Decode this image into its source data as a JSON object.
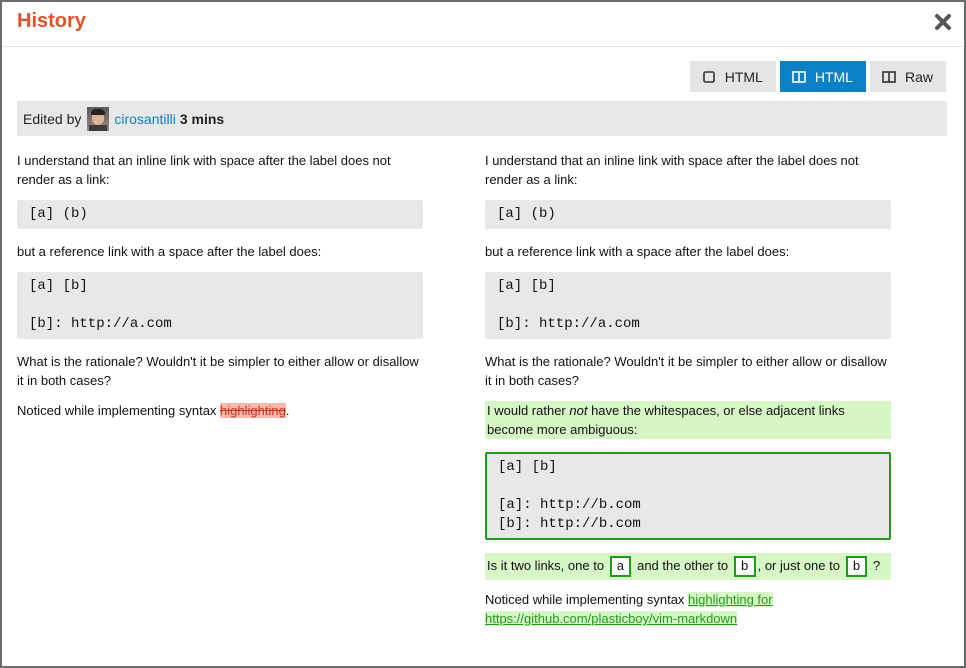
{
  "modal": {
    "title": "History"
  },
  "toolbar": {
    "buttons": [
      {
        "label": "HTML",
        "icon": "square-icon",
        "active": false
      },
      {
        "label": "HTML",
        "icon": "split-columns-icon",
        "active": true
      },
      {
        "label": "Raw",
        "icon": "split-columns-icon",
        "active": false
      }
    ]
  },
  "edit": {
    "prefix": "Edited by",
    "user": "cirosantilli",
    "time": "3 mins"
  },
  "left": {
    "p1": "I understand that an inline link with space after the label does not render as a link:",
    "code1": "[a] (b)",
    "p2": "but a reference link with a space after the label does:",
    "code2": "[a] [b]\n\n[b]: http://a.com",
    "p3": "What is the rationale? Wouldn't it be simpler to either allow or disallow it in both cases?",
    "p4_before": "Noticed while implementing syntax ",
    "p4_deleted": "highlighting",
    "p4_after": "."
  },
  "right": {
    "p1": "I understand that an inline link with space after the label does not render as a link:",
    "code1": "[a] (b)",
    "p2": "but a reference link with a space after the label does:",
    "code2": "[a] [b]\n\n[b]: http://a.com",
    "p3": "What is the rationale? Wouldn't it be simpler to either allow or disallow it in both cases?",
    "ins1_a": "I would rather ",
    "ins1_em": "not",
    "ins1_b": " have the whitespaces, or else adjacent links become more ambiguous:",
    "code3": "[a] [b]\n\n[a]: http://b.com\n[b]: http://b.com",
    "q_a": "Is it two links, one to ",
    "q_box1": "a",
    "q_b": " and the other to ",
    "q_box2": "b",
    "q_c": ", or just one to ",
    "q_box3": "b",
    "q_d": " ?",
    "p4_before": "Noticed while implementing syntax ",
    "p4_link": "highlighting for https://github.com/plasticboy/vim-markdown"
  },
  "colors": {
    "accent": "#e0522d",
    "link": "#0c80c5",
    "inserted": "#d6f6c6",
    "deleted": "#f8b8ab"
  }
}
